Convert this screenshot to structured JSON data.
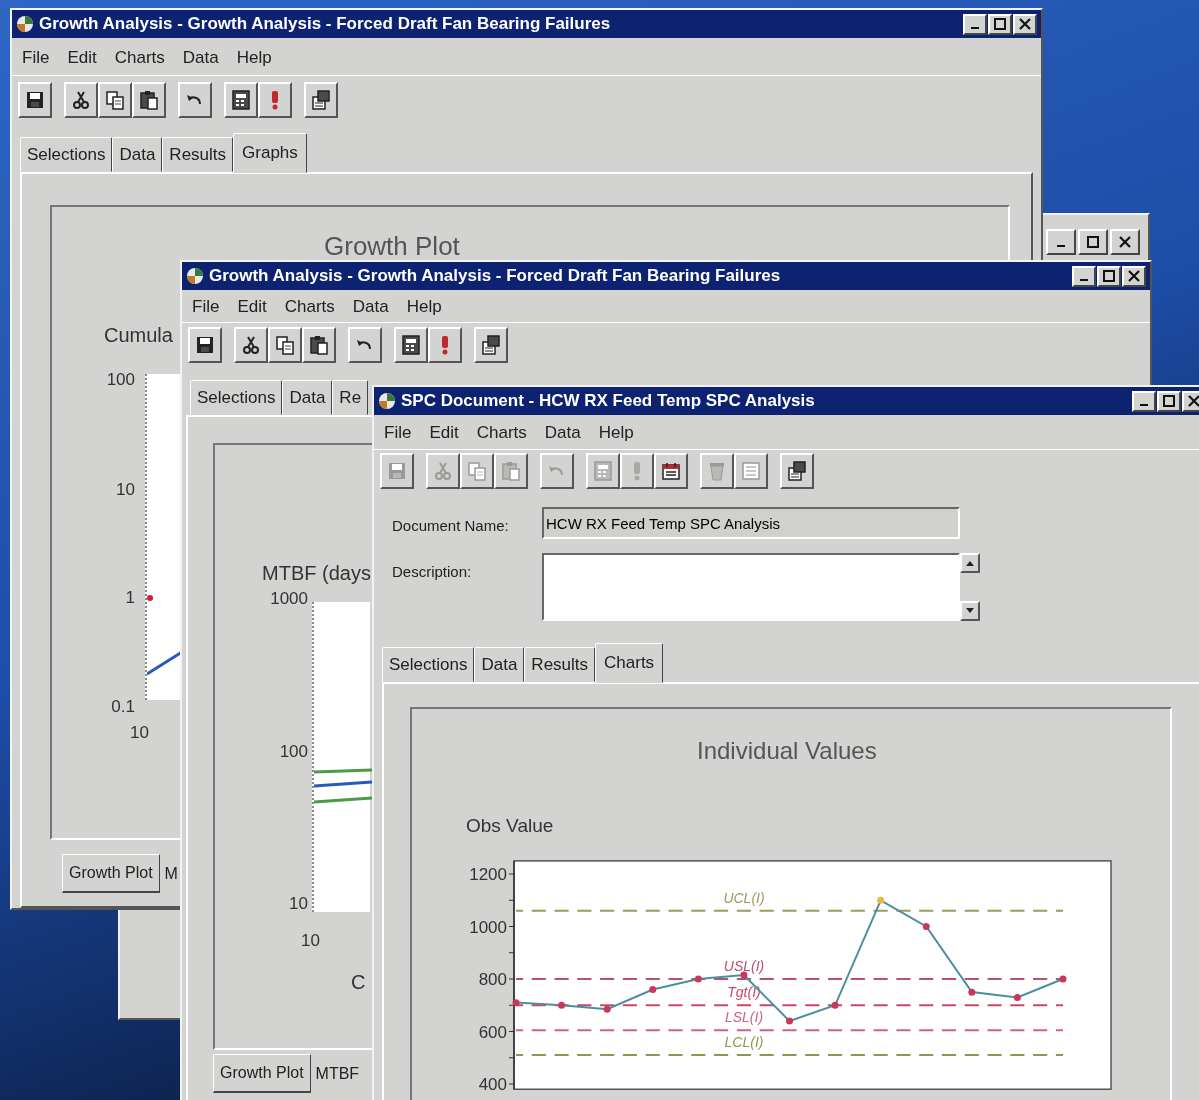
{
  "windows": [
    {
      "kind": "frame"
    },
    {
      "kind": "growth",
      "title": "Growth Analysis - Growth Analysis - Forced Draft Fan Bearing Failures",
      "menu": [
        "File",
        "Edit",
        "Charts",
        "Data",
        "Help"
      ],
      "toolbar": [
        [
          {
            "kind": "save",
            "disabled": false
          }
        ],
        [
          {
            "kind": "cut",
            "disabled": false
          },
          {
            "kind": "copy",
            "disabled": false
          },
          {
            "kind": "paste",
            "disabled": false
          }
        ],
        [
          {
            "kind": "undo",
            "disabled": false
          }
        ],
        [
          {
            "kind": "calculator",
            "disabled": false
          },
          {
            "kind": "alert",
            "disabled": false
          }
        ],
        [
          {
            "kind": "properties",
            "disabled": false
          }
        ]
      ],
      "tabs": [
        {
          "label": "Selections",
          "selected": false
        },
        {
          "label": "Data",
          "selected": false
        },
        {
          "label": "Results",
          "selected": false
        },
        {
          "label": "Graphs",
          "selected": true
        }
      ],
      "chart": {
        "title": "Growth Plot",
        "ylabel": "Cumula",
        "y_tick_labels": [
          "100",
          "10",
          "1",
          "0.1"
        ],
        "x_tick_labels": [
          "10"
        ]
      },
      "bottom_tabs": [
        {
          "label": "Growth Plot",
          "selected": true
        },
        {
          "label": "M",
          "selected": false
        }
      ]
    },
    {
      "kind": "growth",
      "title": "Growth Analysis - Growth Analysis - Forced Draft Fan Bearing Failures",
      "menu": [
        "File",
        "Edit",
        "Charts",
        "Data",
        "Help"
      ],
      "toolbar": [
        [
          {
            "kind": "save",
            "disabled": false
          }
        ],
        [
          {
            "kind": "cut",
            "disabled": false
          },
          {
            "kind": "copy",
            "disabled": false
          },
          {
            "kind": "paste",
            "disabled": false
          }
        ],
        [
          {
            "kind": "undo",
            "disabled": false
          }
        ],
        [
          {
            "kind": "calculator",
            "disabled": false
          },
          {
            "kind": "alert",
            "disabled": false
          }
        ],
        [
          {
            "kind": "properties",
            "disabled": false
          }
        ]
      ],
      "tabs": [
        {
          "label": "Selections",
          "selected": false
        },
        {
          "label": "Data",
          "selected": false
        },
        {
          "label": "Re",
          "selected": false
        }
      ],
      "chart": {
        "ylabel": "MTBF (days",
        "y_tick_labels": [
          "1000",
          "100",
          "10"
        ],
        "x_tick_labels": [
          "10"
        ],
        "xlabel": "C"
      },
      "bottom_tabs": [
        {
          "label": "Growth Plot",
          "selected": true
        },
        {
          "label": "MTBF",
          "selected": false
        }
      ]
    },
    {
      "kind": "spc",
      "title": "SPC Document - HCW RX Feed Temp SPC Analysis",
      "menu": [
        "File",
        "Edit",
        "Charts",
        "Data",
        "Help"
      ],
      "toolbar": [
        [
          {
            "kind": "save",
            "disabled": true
          }
        ],
        [
          {
            "kind": "cut",
            "disabled": true
          },
          {
            "kind": "copy",
            "disabled": true
          },
          {
            "kind": "paste",
            "disabled": true
          }
        ],
        [
          {
            "kind": "undo",
            "disabled": true
          }
        ],
        [
          {
            "kind": "calculator",
            "disabled": true
          },
          {
            "kind": "alert",
            "disabled": true
          },
          {
            "kind": "calendar",
            "disabled": false
          }
        ],
        [
          {
            "kind": "bin",
            "disabled": true
          },
          {
            "kind": "list",
            "disabled": true
          }
        ],
        [
          {
            "kind": "properties",
            "disabled": false
          }
        ]
      ],
      "document_name": {
        "label": "Document Name:",
        "value": "HCW RX Feed Temp SPC Analysis",
        "disabled": true
      },
      "description": {
        "label": "Description:"
      },
      "tabs": [
        {
          "label": "Selections",
          "selected": false
        },
        {
          "label": "Data",
          "selected": false
        },
        {
          "label": "Results",
          "selected": false
        },
        {
          "label": "Charts",
          "selected": true
        }
      ],
      "chart_data": {
        "type": "line",
        "title": "Individual Values",
        "ylabel": "Obs Value",
        "ylim": [
          380,
          1250
        ],
        "yticks": [
          400,
          600,
          800,
          1000,
          1200
        ],
        "series": [
          {
            "color": "#4a8fa0",
            "marker": "circle",
            "line_style": "solid",
            "values": [
              710,
              700,
              685,
              760,
              800,
              815,
              640,
              700,
              1100,
              1000,
              750,
              730,
              800
            ]
          },
          {
            "name": "UCL(I)",
            "color": "#9c9a5c",
            "marker": "none",
            "line_style": "dashed",
            "values": [
              1060,
              1060,
              1060,
              1060,
              1060,
              1060,
              1060,
              1060,
              1060,
              1060,
              1060,
              1060,
              1060
            ]
          },
          {
            "name": "USL(I)",
            "color": "#b8506e",
            "marker": "none",
            "line_style": "dashed",
            "values": [
              800,
              800,
              800,
              800,
              800,
              800,
              800,
              800,
              800,
              800,
              800,
              800,
              800
            ]
          },
          {
            "name": "Tgt(I)",
            "color": "#c8486a",
            "marker": "none",
            "line_style": "dashed",
            "values": [
              700,
              700,
              700,
              700,
              700,
              700,
              700,
              700,
              700,
              700,
              700,
              700,
              700
            ]
          },
          {
            "name": "LSL(I)",
            "color": "#d06088",
            "marker": "none",
            "line_style": "dashed",
            "values": [
              605,
              605,
              605,
              605,
              605,
              605,
              605,
              605,
              605,
              605,
              605,
              605,
              605
            ]
          },
          {
            "name": "LCL(I)",
            "color": "#8a9a50",
            "marker": "none",
            "line_style": "dashed",
            "values": [
              510,
              510,
              510,
              510,
              510,
              510,
              510,
              510,
              510,
              510,
              510,
              510,
              510
            ]
          }
        ]
      }
    }
  ]
}
